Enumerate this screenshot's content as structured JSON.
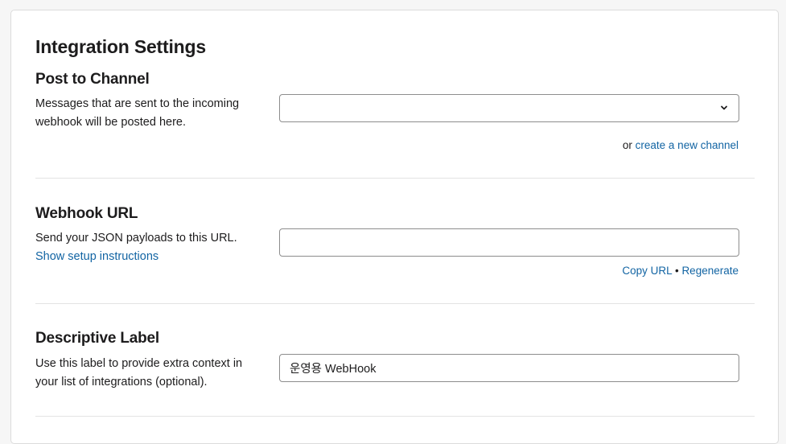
{
  "page": {
    "title": "Integration Settings"
  },
  "post_to_channel": {
    "heading": "Post to Channel",
    "description": "Messages that are sent to the incoming webhook will be posted here.",
    "select_value": "",
    "alt_prefix": "or",
    "create_channel_link": "create a new channel",
    "chevron_icon": "chevron-down-icon"
  },
  "webhook_url": {
    "heading": "Webhook URL",
    "description": "Send your JSON payloads to this URL.",
    "setup_link": "Show setup instructions",
    "url_value": "",
    "copy_link": "Copy URL",
    "separator": "•",
    "regenerate_link": "Regenerate"
  },
  "descriptive_label": {
    "heading": "Descriptive Label",
    "description": "Use this label to provide extra context in your list of integrations (optional).",
    "label_value": "운영용 WebHook"
  },
  "colors": {
    "link": "#1264a3",
    "text": "#1d1c1d",
    "border": "#8d8d8d",
    "divider": "#e3e3e3"
  }
}
